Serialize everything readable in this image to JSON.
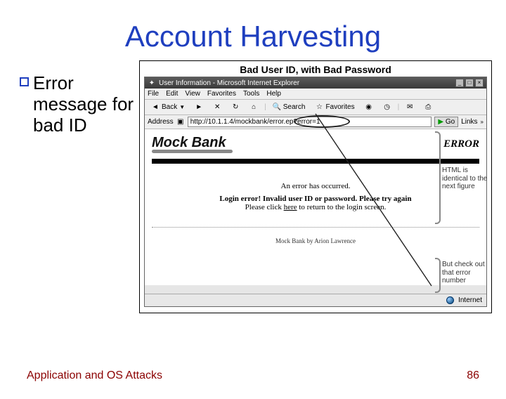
{
  "title": "Account Harvesting",
  "bullet": "Error message for bad ID",
  "figure": {
    "caption": "Bad User ID, with Bad Password",
    "browser": {
      "window_title": "User Information - Microsoft Internet Explorer",
      "menus": [
        "File",
        "Edit",
        "View",
        "Favorites",
        "Tools",
        "Help"
      ],
      "toolbar": {
        "back": "Back",
        "search": "Search",
        "favorites": "Favorites"
      },
      "address_label": "Address",
      "address_value": "http://10.1.1.4/mockbank/error.ep?error=1",
      "go": "Go",
      "links": "Links",
      "page": {
        "logo": "Mock Bank",
        "error_word": "ERROR",
        "err1": "An error has occurred.",
        "err2": "Login error! Invalid user ID or password. Please try again",
        "err3_pre": "Please click ",
        "err3_here": "here",
        "err3_post": " to return to the login screen.",
        "byline": "Mock Bank by Arion Lawrence"
      },
      "status": "Internet"
    },
    "annot1": "HTML is identical to the next figure",
    "annot2": "But check out that error number"
  },
  "footer": {
    "left": "Application and OS Attacks",
    "right": "86"
  }
}
